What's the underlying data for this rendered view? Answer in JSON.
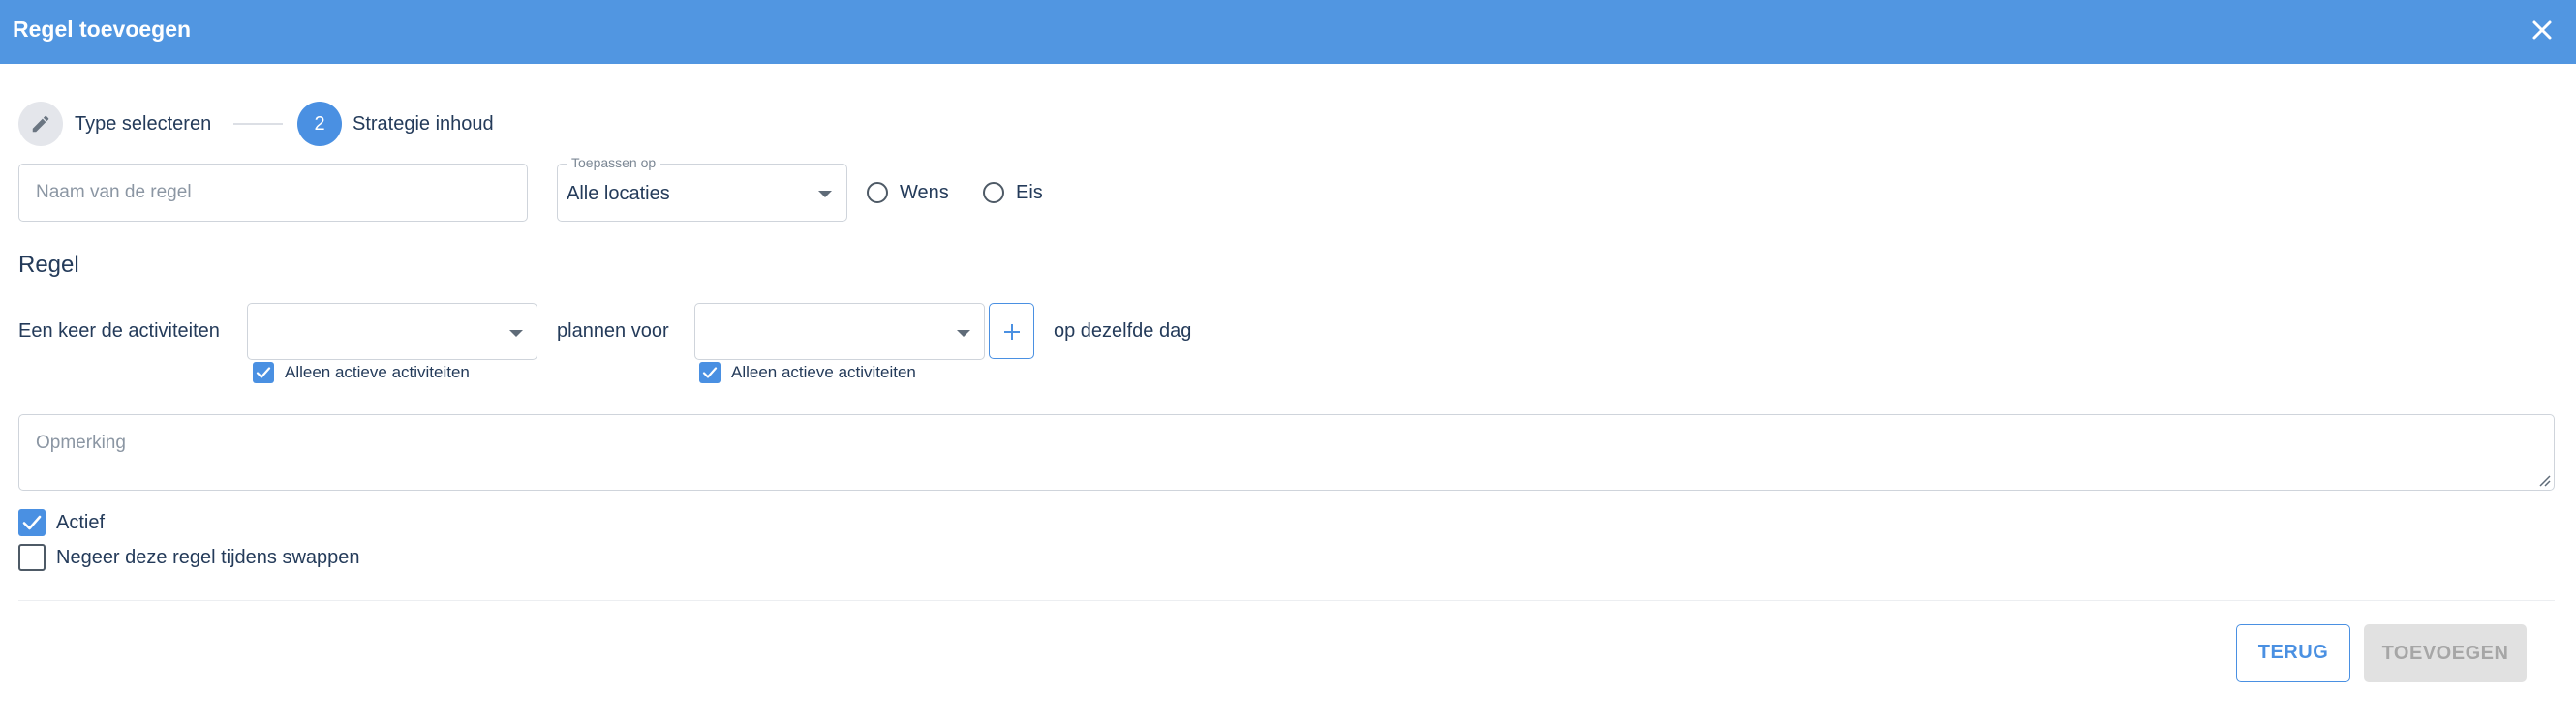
{
  "dialog": {
    "title": "Regel toevoegen",
    "close_icon": "close-icon"
  },
  "stepper": {
    "steps": [
      {
        "label": "Type selecteren",
        "icon": "pencil-icon",
        "state": "completed"
      },
      {
        "label": "Strategie inhoud",
        "number": "2",
        "state": "active"
      }
    ]
  },
  "form": {
    "name_placeholder": "Naam van de regel",
    "apply_label": "Toepassen op",
    "apply_value": "Alle locaties",
    "priority_options": [
      {
        "label": "Wens",
        "selected": false
      },
      {
        "label": "Eis",
        "selected": false
      }
    ]
  },
  "rule": {
    "section_title": "Regel",
    "text_before": "Een keer de activiteiten",
    "text_middle": "plannen voor",
    "text_after": "op dezelfde dag",
    "activities_select_value": "",
    "target_select_value": "",
    "only_active_label_1": "Alleen actieve activiteiten",
    "only_active_checked_1": true,
    "only_active_label_2": "Alleen actieve activiteiten",
    "only_active_checked_2": true,
    "add_icon": "plus-icon"
  },
  "remark": {
    "placeholder": "Opmerking"
  },
  "options": {
    "active_label": "Actief",
    "active_checked": true,
    "ignore_swap_label": "Negeer deze regel tijdens swappen",
    "ignore_swap_checked": false
  },
  "footer": {
    "back_label": "TERUG",
    "add_label": "TOEVOEGEN",
    "add_disabled": true
  },
  "colors": {
    "header": "#5196e1",
    "accent": "#4a90e2",
    "text": "#243b5a",
    "disabled_bg": "#e1e1e1",
    "disabled_text": "#a6a6a6"
  }
}
